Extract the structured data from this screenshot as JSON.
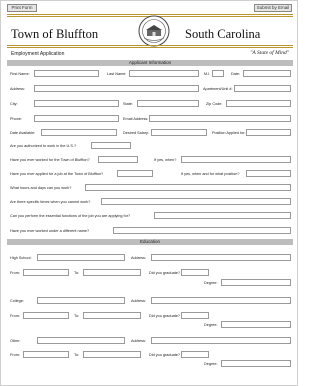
{
  "toolbar": {
    "print_label": "Print Form",
    "email_label": "Submit by Email"
  },
  "header": {
    "town": "Town of Bluffton",
    "state": "South Carolina",
    "subtitle": "Employment Application",
    "motto": "\"A State of Mind\""
  },
  "colors": {
    "accent_gold": "#b9962e",
    "band_gray": "#bdbdbd"
  },
  "sections": {
    "applicant": "Applicant Information",
    "education": "Education"
  },
  "labels": {
    "first_name": "First Name:",
    "last_name": "Last Name:",
    "mi": "M.I.",
    "date": "Date:",
    "address": "Address:",
    "apt": "Apartment/Unit #:",
    "city": "City:",
    "state": "State:",
    "zip": "Zip Code:",
    "phone": "Phone:",
    "email": "Email Address:",
    "date_available": "Date Available:",
    "desired_salary": "Desired Salary:",
    "position": "Position Applied for:",
    "authorized": "Are you authorized to work in the U.S.?",
    "worked_before": "Have you ever worked for the Town of Bluffton?",
    "if_yes_when": "If yes, when?",
    "applied_before": "Have you ever applied for a job at the Town of Bluffton?",
    "if_yes_position": "If yes, when and for what position?",
    "hours": "What hours and days can you work?",
    "cannot_work": "Are there specific times when you cannot work?",
    "essential": "Can you perform the essential functions of the job you are applying for?",
    "other_name": "Have you ever worked under a different name?",
    "high_school": "High School:",
    "college": "College:",
    "other": "Other:",
    "edu_address": "Address:",
    "from": "From:",
    "to": "To:",
    "graduate": "Did you graduate?",
    "degree": "Degree:"
  }
}
